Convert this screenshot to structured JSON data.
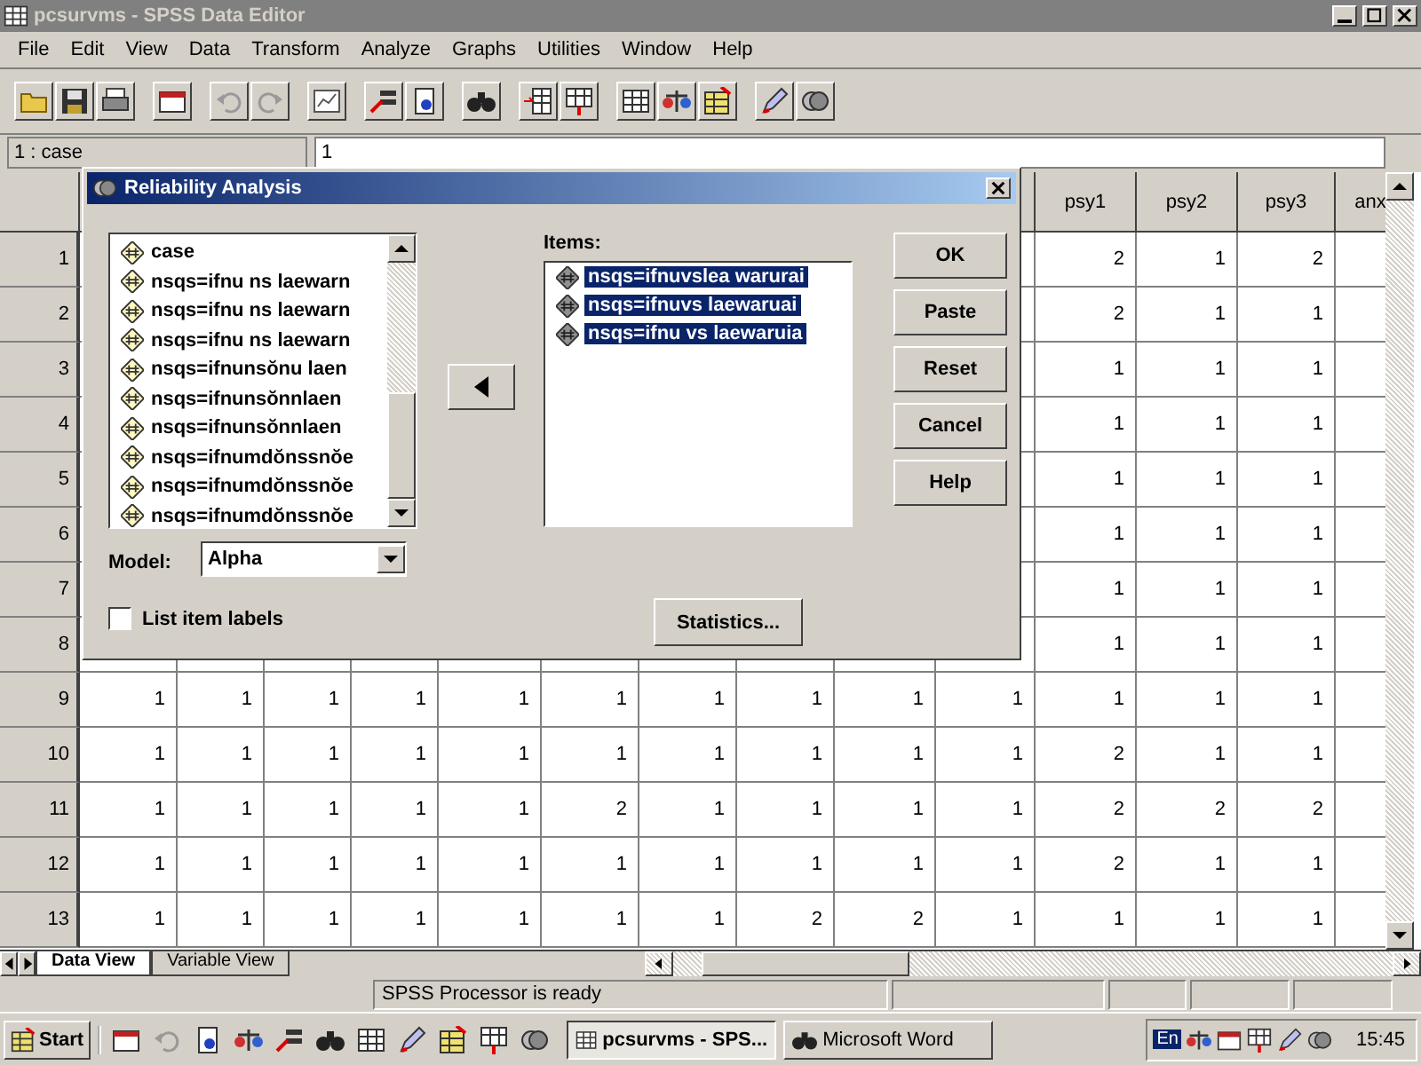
{
  "window": {
    "title": "pcsurvms - SPSS Data Editor"
  },
  "menu": [
    "File",
    "Edit",
    "View",
    "Data",
    "Transform",
    "Analyze",
    "Graphs",
    "Utilities",
    "Window",
    "Help"
  ],
  "cell_editor": {
    "cell": "1 : case",
    "value": "1"
  },
  "table": {
    "columns": [
      {
        "label": "psy1"
      },
      {
        "label": "psy2"
      },
      {
        "label": "psy3"
      },
      {
        "label": "anx"
      }
    ],
    "rows": [
      {
        "number": "1",
        "cells": [
          "2",
          "1",
          "2"
        ]
      },
      {
        "number": "2",
        "cells": [
          "2",
          "1",
          "1"
        ]
      },
      {
        "number": "3",
        "cells": [
          "1",
          "1",
          "1"
        ]
      },
      {
        "number": "4",
        "cells": [
          "1",
          "1",
          "1"
        ]
      },
      {
        "number": "5",
        "cells": [
          "1",
          "1",
          "1"
        ]
      },
      {
        "number": "6",
        "cells": [
          "1",
          "1",
          "1"
        ]
      },
      {
        "number": "7",
        "cells": [
          "1",
          "1",
          "1"
        ]
      },
      {
        "number": "8",
        "cells": [
          "1",
          "1",
          "1"
        ]
      },
      {
        "number": "9",
        "cells": [
          "1",
          "1",
          "1",
          "1",
          "1",
          "1",
          "1",
          "1",
          "1",
          "1",
          "1",
          "1",
          "1"
        ]
      },
      {
        "number": "10",
        "cells": [
          "1",
          "1",
          "1",
          "1",
          "1",
          "1",
          "1",
          "1",
          "1",
          "1",
          "2",
          "1",
          "1"
        ]
      },
      {
        "number": "11",
        "cells": [
          "1",
          "1",
          "1",
          "1",
          "1",
          "2",
          "1",
          "1",
          "1",
          "1",
          "2",
          "2",
          "2"
        ]
      },
      {
        "number": "12",
        "cells": [
          "1",
          "1",
          "1",
          "1",
          "1",
          "1",
          "1",
          "1",
          "1",
          "1",
          "2",
          "1",
          "1"
        ]
      },
      {
        "number": "13",
        "cells": [
          "1",
          "1",
          "1",
          "1",
          "1",
          "1",
          "1",
          "2",
          "2",
          "1",
          "1",
          "1",
          "1"
        ]
      }
    ]
  },
  "view_tabs": [
    {
      "label": "Data View",
      "selected": true
    },
    {
      "label": "Variable View",
      "selected": false
    }
  ],
  "status_bar": {
    "message": "SPSS Processor  is ready"
  },
  "dialog": {
    "title": "Reliability Analysis",
    "variables": [
      "case",
      "nsqs=ifnu ns laewarn",
      "nsqs=ifnu ns laewarn",
      "nsqs=ifnu ns laewarn",
      "nsqs=ifnunsŏnu laen",
      "nsqs=ifnunsŏnnlaen",
      "nsqs=ifnunsŏnnlaen",
      "nsqs=ifnumdŏnssnŏe",
      "nsqs=ifnumdŏnssnŏe",
      "nsqs=ifnumdŏnssnŏe"
    ],
    "items_label": "Items:",
    "items": [
      {
        "label": "nsqs=ifnuvslea warurai",
        "selected": true
      },
      {
        "label": "nsqs=ifnuvs laewaruai",
        "selected": true
      },
      {
        "label": "nsqs=ifnu vs laewaruia",
        "selected": true
      }
    ],
    "model_label": "Model:",
    "model": "Alpha",
    "list_item_labels": {
      "label": "List item labels",
      "checked": false
    },
    "statistics_button": "Statistics...",
    "buttons": [
      "OK",
      "Paste",
      "Reset",
      "Cancel",
      "Help"
    ]
  },
  "taskbar": {
    "start": "Start",
    "tasks": [
      {
        "label": "pcsurvms - SPS...",
        "selected": true
      },
      {
        "label": "Microsoft Word",
        "selected": false
      }
    ],
    "language": "En",
    "clock": "15:45"
  }
}
